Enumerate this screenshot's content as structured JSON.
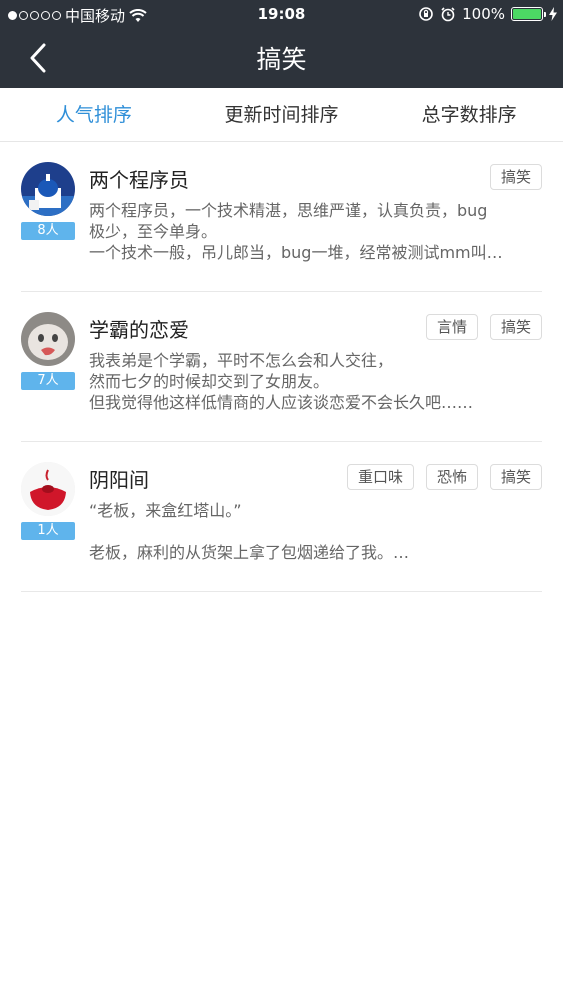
{
  "status": {
    "carrier": "中国移动",
    "time": "19:08",
    "battery": "100%"
  },
  "nav": {
    "title": "搞笑"
  },
  "tabs": [
    {
      "label": "人气排序"
    },
    {
      "label": "更新时间排序"
    },
    {
      "label": "总字数排序"
    }
  ],
  "items": [
    {
      "title": "两个程序员",
      "count": "8人",
      "tags": [
        "搞笑"
      ],
      "lines": [
        "两个程序员，一个技术精湛，思维严谨，认真负责，bug",
        "极少，至今单身。",
        "一个技术一般，吊儿郎当，bug一堆，经常被测试mm叫…"
      ]
    },
    {
      "title": "学霸的恋爱",
      "count": "7人",
      "tags": [
        "言情",
        "搞笑"
      ],
      "lines": [
        "我表弟是个学霸，平时不怎么会和人交往，",
        "然而七夕的时候却交到了女朋友。",
        "但我觉得他这样低情商的人应该谈恋爱不会长久吧……"
      ]
    },
    {
      "title": "阴阳间",
      "count": "1人",
      "tags": [
        "重口味",
        "恐怖",
        "搞笑"
      ],
      "lines": [
        "“老板，来盒红塔山。”",
        "",
        "老板，麻利的从货架上拿了包烟递给了我。…"
      ]
    }
  ],
  "colors": {
    "header_bg": "#2d333b",
    "accent": "#2f8fd8",
    "badge": "#5fb4ec"
  }
}
